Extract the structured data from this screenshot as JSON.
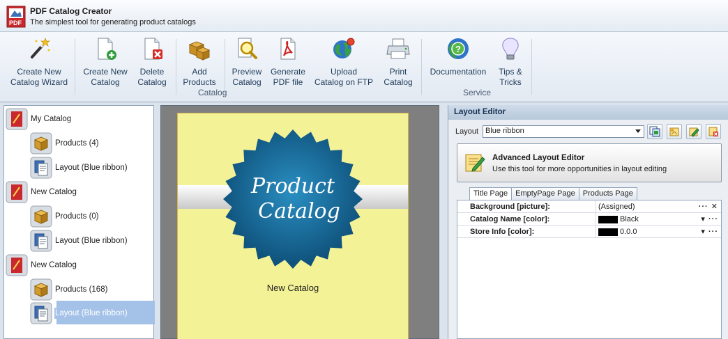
{
  "app": {
    "title": "PDF Catalog Creator",
    "subtitle": "The simplest tool for generating product catalogs"
  },
  "ribbon": {
    "buttons": [
      {
        "line1": "Create New",
        "line2": "Catalog Wizard",
        "icon": "magic-wand-icon"
      },
      {
        "line1": "Create New",
        "line2": "Catalog",
        "icon": "new-document-icon"
      },
      {
        "line1": "Delete",
        "line2": "Catalog",
        "icon": "delete-document-icon"
      },
      {
        "line1": "Add",
        "line2": "Products",
        "icon": "boxes-icon"
      },
      {
        "line1": "Preview",
        "line2": "Catalog",
        "icon": "magnifier-icon"
      },
      {
        "line1": "Generate",
        "line2": "PDF file",
        "icon": "pdf-icon"
      },
      {
        "line1": "Upload",
        "line2": "Catalog on FTP",
        "icon": "globe-icon"
      },
      {
        "line1": "Print",
        "line2": "Catalog",
        "icon": "printer-icon"
      },
      {
        "line1": "Documentation",
        "line2": "",
        "icon": "help-globe-icon"
      },
      {
        "line1": "Tips &",
        "line2": "Tricks",
        "icon": "lightbulb-icon"
      }
    ],
    "groups": {
      "catalog": "Catalog",
      "service": "Service"
    }
  },
  "tree": {
    "items": [
      {
        "label": "My Catalog",
        "type": "catalog"
      },
      {
        "label": "Products (4)",
        "type": "products"
      },
      {
        "label": "Layout (Blue ribbon)",
        "type": "layout"
      },
      {
        "label": "New Catalog",
        "type": "catalog"
      },
      {
        "label": "Products (0)",
        "type": "products"
      },
      {
        "label": "Layout (Blue ribbon)",
        "type": "layout"
      },
      {
        "label": "New Catalog",
        "type": "catalog"
      },
      {
        "label": "Products (168)",
        "type": "products"
      },
      {
        "label": "Layout (Blue ribbon)",
        "type": "layout",
        "selected": true
      }
    ]
  },
  "preview": {
    "badge_line1": "Product",
    "badge_line2": "Catalog",
    "catalog_name": "New Catalog",
    "page_color": "#f4f297",
    "badge_color": "#1a6d9a"
  },
  "layout_editor": {
    "header": "Layout Editor",
    "layout_label": "Layout",
    "layout_value": "Blue ribbon",
    "advanced_title": "Advanced Layout Editor",
    "advanced_sub": "Use this tool for more opportunities in layout editing",
    "tabs": [
      "Title Page",
      "EmptyPage Page",
      "Products Page"
    ],
    "properties": [
      {
        "name": "Background [picture]:",
        "value": "(Assigned)",
        "swatch": "",
        "buttons": "··· ✕"
      },
      {
        "name": "Catalog Name [color]:",
        "value": "Black",
        "swatch": "#000000",
        "buttons": "▾ ···"
      },
      {
        "name": "Store Info [color]:",
        "value": "0.0.0",
        "swatch": "#000000",
        "buttons": "▾ ···"
      }
    ]
  }
}
